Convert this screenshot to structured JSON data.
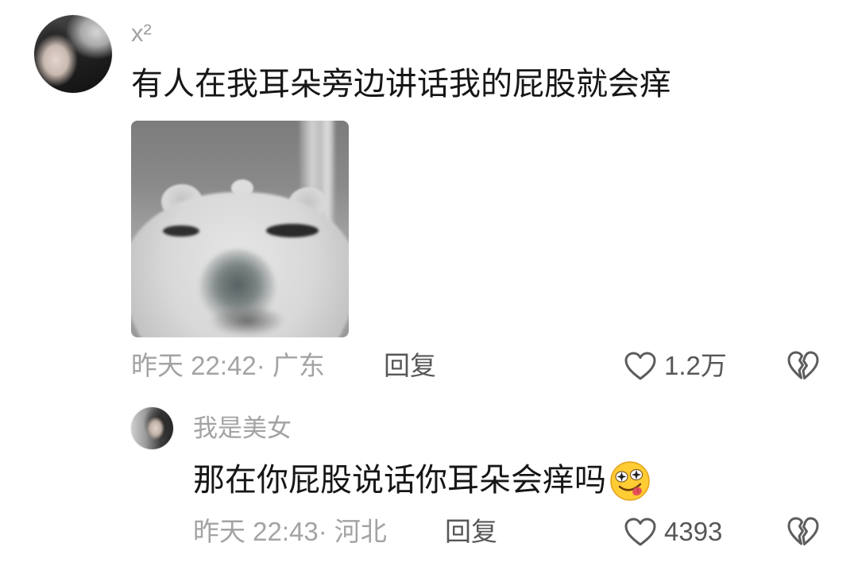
{
  "colors": {
    "background": "#ffffff",
    "text_primary": "#161616",
    "text_secondary": "#a3a3a3",
    "action_text": "#575757",
    "icon_stroke": "#5c5c5c"
  },
  "comment": {
    "username": "x²",
    "text": "有人在我耳朵旁边讲话我的屁股就会痒",
    "meta": "昨天 22:42· 广东",
    "reply_label": "回复",
    "like_count": "1.2万",
    "icons": {
      "like": "heart-outline-icon",
      "dislike": "broken-heart-icon"
    }
  },
  "reply": {
    "username": "我是美女",
    "text": "那在你屁股说话你耳朵会痒吗",
    "emoji": "star-eyes-tongue-out-emoji",
    "meta": "昨天 22:43· 河北",
    "reply_label": "回复",
    "like_count": "4393",
    "icons": {
      "like": "heart-outline-icon",
      "dislike": "broken-heart-icon"
    }
  }
}
